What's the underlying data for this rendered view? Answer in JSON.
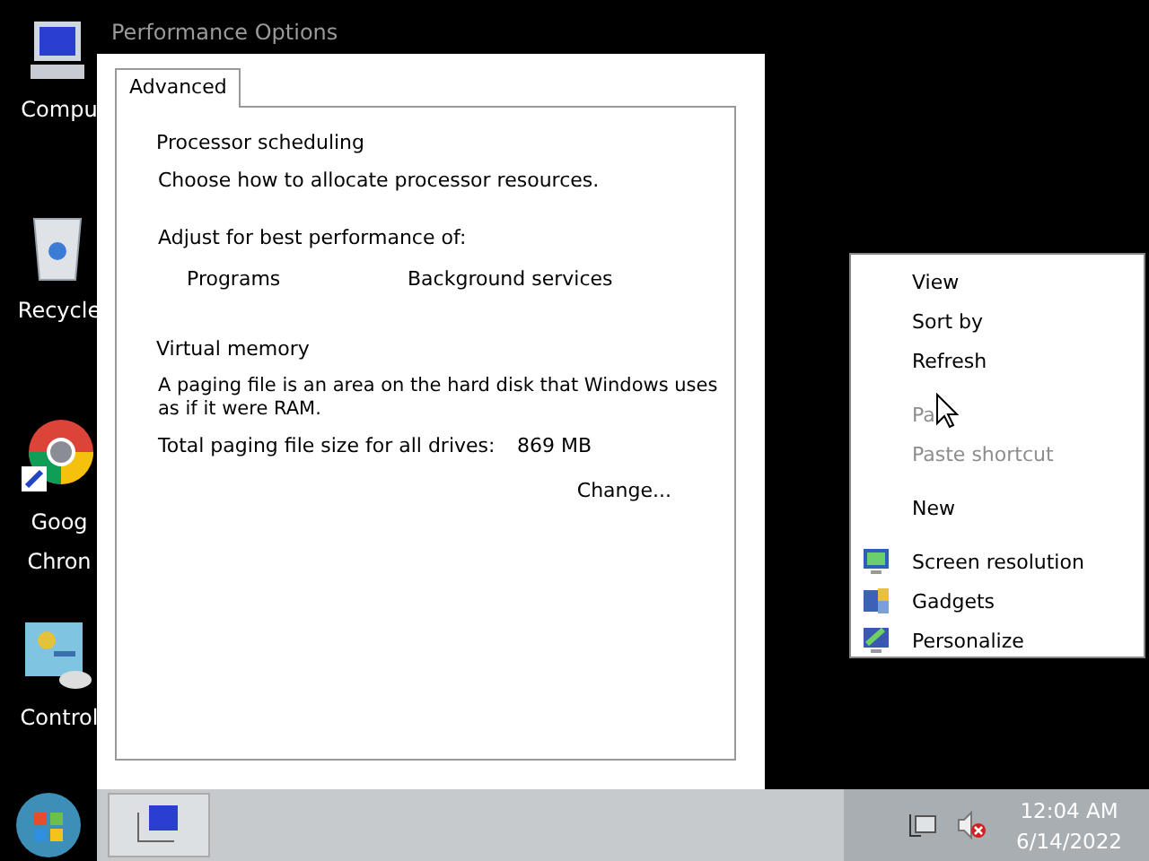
{
  "desktop_icons": [
    {
      "label_lines": [
        "Compu"
      ],
      "kind": "computer"
    },
    {
      "label_lines": [
        "Recycle"
      ],
      "kind": "recycle"
    },
    {
      "label_lines": [
        "Goog",
        "Chron"
      ],
      "kind": "browser"
    },
    {
      "label_lines": [
        "Control"
      ],
      "kind": "control"
    }
  ],
  "window": {
    "title": "Performance Options"
  },
  "tabs": [
    {
      "label": "Advanced",
      "selected": true
    }
  ],
  "processor_scheduling": {
    "heading": "Processor scheduling",
    "description": "Choose how to allocate processor resources.",
    "adjust_label": "Adjust for best performance of:",
    "options": [
      "Programs",
      "Background services"
    ]
  },
  "virtual_memory": {
    "heading": "Virtual memory",
    "description": "A paging file is an area on the hard disk that Windows uses as if it were RAM.",
    "total_label": "Total paging file size for all drives:",
    "total_value": "869 MB",
    "change_button": "Change..."
  },
  "context_menu": {
    "groups": [
      [
        {
          "label": "View",
          "disabled": false,
          "kind": "text"
        },
        {
          "label": "Sort by",
          "disabled": false,
          "kind": "text"
        },
        {
          "label": "Refresh",
          "disabled": false,
          "kind": "text"
        }
      ],
      [
        {
          "label": "Pa",
          "disabled": true,
          "kind": "text"
        },
        {
          "label": "Paste shortcut",
          "disabled": true,
          "kind": "text"
        }
      ],
      [
        {
          "label": "New",
          "disabled": false,
          "kind": "text"
        }
      ],
      [
        {
          "label": "Screen resolution",
          "disabled": false,
          "kind": "screen"
        },
        {
          "label": "Gadgets",
          "disabled": false,
          "kind": "gadgets"
        },
        {
          "label": "Personalize",
          "disabled": false,
          "kind": "personalize"
        }
      ]
    ]
  },
  "taskbar": {
    "clock_time": "12:04 AM",
    "clock_date": "6/14/2022",
    "volume_muted": true
  }
}
